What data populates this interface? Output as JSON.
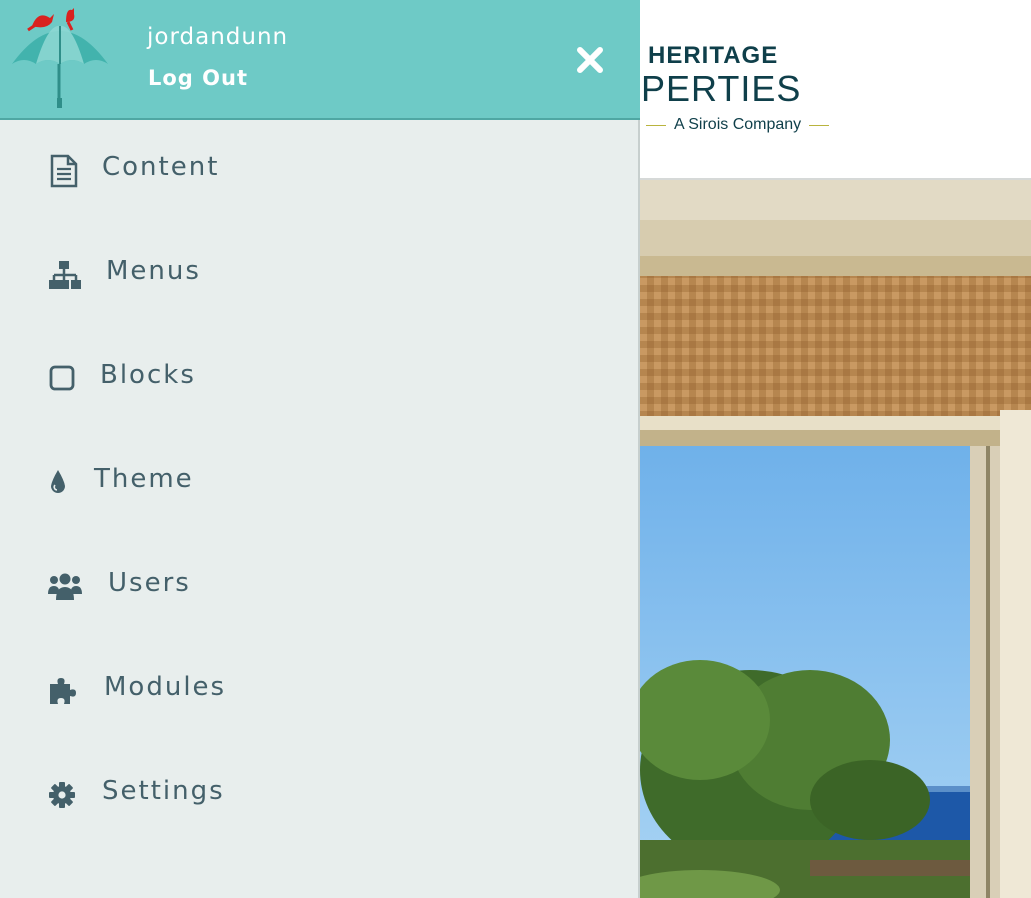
{
  "site": {
    "logo": {
      "line1": "AUA‘I HERITAGE",
      "line2": "PROPERTIES",
      "line3": "A Sirois Company"
    }
  },
  "drawer": {
    "username": "jordandunn",
    "logout_label": "Log Out",
    "close_icon": "close-icon",
    "colors": {
      "header_bg": "#6ecac6",
      "panel_bg": "#e8eeed",
      "menu_text": "#44606a"
    },
    "menu": [
      {
        "icon": "document-icon",
        "label": "Content"
      },
      {
        "icon": "sitemap-icon",
        "label": "Menus"
      },
      {
        "icon": "square-icon",
        "label": "Blocks"
      },
      {
        "icon": "droplet-icon",
        "label": "Theme"
      },
      {
        "icon": "users-icon",
        "label": "Users"
      },
      {
        "icon": "puzzle-icon",
        "label": "Modules"
      },
      {
        "icon": "gear-icon",
        "label": "Settings"
      }
    ]
  }
}
